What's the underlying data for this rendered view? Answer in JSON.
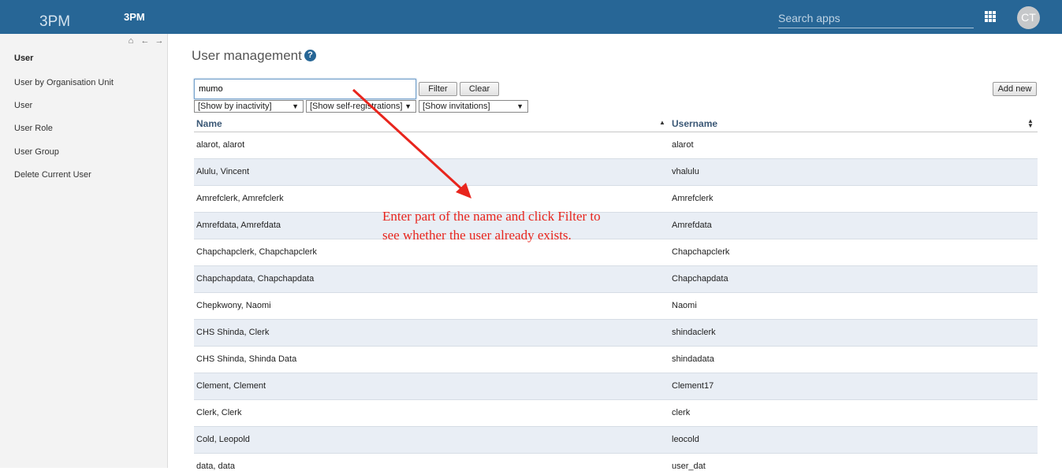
{
  "header": {
    "logo": "3PM",
    "app_title": "3PM",
    "search_placeholder": "Search apps",
    "avatar_initials": "CT"
  },
  "sidebar": {
    "items": [
      {
        "label": "User",
        "active": true
      },
      {
        "label": "User by Organisation Unit"
      },
      {
        "label": "User"
      },
      {
        "label": "User Role"
      },
      {
        "label": "User Group"
      },
      {
        "label": "Delete Current User"
      }
    ]
  },
  "main": {
    "title": "User management",
    "filter_value": "mumo",
    "filter_button": "Filter",
    "clear_button": "Clear",
    "add_new_button": "Add new",
    "selects": [
      "[Show by inactivity]",
      "[Show self-registrations]",
      "[Show invitations]"
    ],
    "columns": [
      "Name",
      "Username"
    ],
    "rows": [
      {
        "name": "alarot, alarot",
        "username": "alarot"
      },
      {
        "name": "Alulu, Vincent",
        "username": "vhalulu"
      },
      {
        "name": "Amrefclerk, Amrefclerk",
        "username": "Amrefclerk"
      },
      {
        "name": "Amrefdata, Amrefdata",
        "username": "Amrefdata"
      },
      {
        "name": "Chapchapclerk, Chapchapclerk",
        "username": "Chapchapclerk"
      },
      {
        "name": "Chapchapdata, Chapchapdata",
        "username": "Chapchapdata"
      },
      {
        "name": "Chepkwony, Naomi",
        "username": "Naomi"
      },
      {
        "name": "CHS Shinda, Clerk",
        "username": "shindaclerk"
      },
      {
        "name": "CHS Shinda, Shinda Data",
        "username": "shindadata"
      },
      {
        "name": "Clement, Clement",
        "username": "Clement17"
      },
      {
        "name": "Clerk, Clerk",
        "username": "clerk"
      },
      {
        "name": "Cold, Leopold",
        "username": "leocold"
      },
      {
        "name": "data, data",
        "username": "user_dat"
      }
    ]
  },
  "annotation": {
    "line1": "Enter part of the name and click Filter to",
    "line2": "see whether the user already exists.",
    "color": "#e8251d"
  },
  "colors": {
    "header_bg": "#276696",
    "row_alt": "#e9eef5"
  }
}
